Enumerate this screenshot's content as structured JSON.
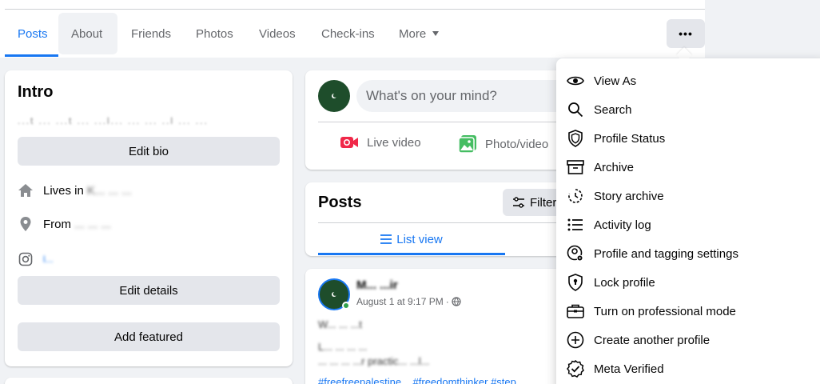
{
  "tabs": [
    {
      "label": "Posts"
    },
    {
      "label": "About"
    },
    {
      "label": "Friends"
    },
    {
      "label": "Photos"
    },
    {
      "label": "Videos"
    },
    {
      "label": "Check-ins"
    },
    {
      "label": "More"
    }
  ],
  "more_options_label": "•••",
  "intro": {
    "title": "Intro",
    "bio_blurred": "...t ... ...t ... ...l... ... ... ..l ... ...",
    "edit_bio": "Edit bio",
    "lives_in_prefix": "Lives in",
    "lives_in_value": "K... ... ...",
    "from_prefix": "From",
    "from_value": "... ... ...",
    "instagram_value": "l...",
    "edit_details": "Edit details",
    "add_featured": "Add featured"
  },
  "composer": {
    "placeholder": "What's on your mind?",
    "live_video": "Live video",
    "photo_video": "Photo/video"
  },
  "posts_section": {
    "title": "Posts",
    "filter_label": "Filters",
    "list_view": "List view"
  },
  "post": {
    "author": "M... ...ir",
    "date": "August 1 at 9:17 PM",
    "separator": "·",
    "line1": "W... ... ...t",
    "line2": "L... ... ... ...",
    "line3": "... ... ... ...r practic... ...l...",
    "hashtags": "#freefreepalestine... #freedomthinker #step..."
  },
  "menu": {
    "items": [
      {
        "label": "View As",
        "icon": "eye-icon"
      },
      {
        "label": "Search",
        "icon": "search-icon"
      },
      {
        "label": "Profile Status",
        "icon": "shield-icon"
      },
      {
        "label": "Archive",
        "icon": "archive-icon"
      },
      {
        "label": "Story archive",
        "icon": "story-archive-icon"
      },
      {
        "label": "Activity log",
        "icon": "list-icon"
      },
      {
        "label": "Profile and tagging settings",
        "icon": "profile-settings-icon"
      },
      {
        "label": "Lock profile",
        "icon": "lock-shield-icon"
      },
      {
        "label": "Turn on professional mode",
        "icon": "briefcase-icon"
      },
      {
        "label": "Create another profile",
        "icon": "plus-circle-icon"
      },
      {
        "label": "Meta Verified",
        "icon": "verified-icon"
      }
    ]
  },
  "colors": {
    "accent": "#1877f2",
    "button_bg": "#e4e6eb",
    "page_bg": "#f0f2f5",
    "secondary_text": "#65676b",
    "live_red": "#f02849",
    "photo_green": "#45bd62",
    "avatar_green": "#1e4d2b"
  }
}
